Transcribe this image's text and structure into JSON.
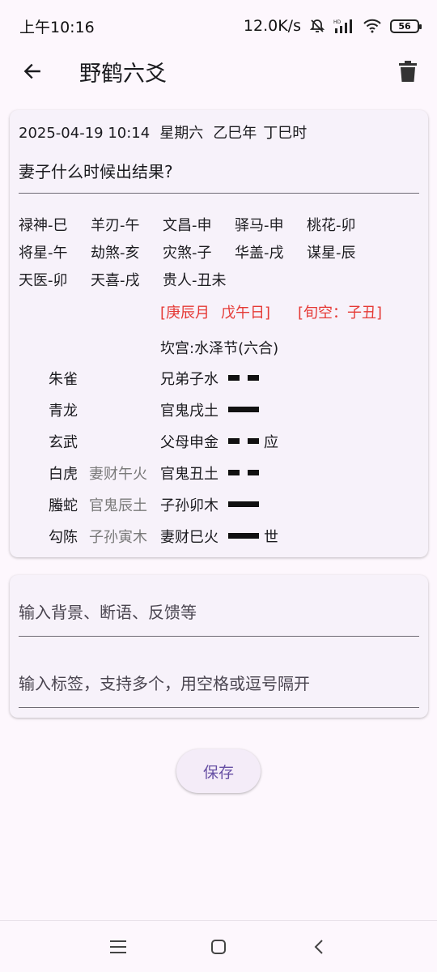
{
  "status": {
    "time": "上午10:16",
    "network_speed": "12.0K/s",
    "battery": "56"
  },
  "app_bar": {
    "title": "野鹤六爻"
  },
  "record": {
    "date_time": "2025-04-19 10:14",
    "weekday": "星期六",
    "year_pillar": "乙巳年",
    "hour_pillar": "丁巳时",
    "question": "妻子什么时候出结果?",
    "shensha": [
      [
        "禄神-巳",
        "羊刃-午",
        "文昌-申",
        "驿马-申",
        "桃花-卯"
      ],
      [
        "将星-午",
        "劫煞-亥",
        "灾煞-子",
        "华盖-戌",
        "谋星-辰"
      ],
      [
        "天医-卯",
        "天喜-戌",
        "贵人-丑未"
      ]
    ],
    "month": "[庚辰月",
    "day": "戊午日]",
    "xunkong": "[旬空：子丑]",
    "gua": "坎宫:水泽节(六合)",
    "yaos": [
      {
        "god": "朱雀",
        "fushen": "",
        "liuqin": "兄弟子水",
        "type": "yin",
        "mark": ""
      },
      {
        "god": "青龙",
        "fushen": "",
        "liuqin": "官鬼戌土",
        "type": "yang",
        "mark": ""
      },
      {
        "god": "玄武",
        "fushen": "",
        "liuqin": "父母申金",
        "type": "yin",
        "mark": "应"
      },
      {
        "god": "白虎",
        "fushen": "妻财午火",
        "liuqin": "官鬼丑土",
        "type": "yin",
        "mark": ""
      },
      {
        "god": "螣蛇",
        "fushen": "官鬼辰土",
        "liuqin": "子孙卯木",
        "type": "yang",
        "mark": ""
      },
      {
        "god": "勾陈",
        "fushen": "子孙寅木",
        "liuqin": "妻财巳火",
        "type": "yang",
        "mark": "世"
      }
    ]
  },
  "inputs": {
    "notes_placeholder": "输入背景、断语、反馈等",
    "notes_value": "",
    "tags_placeholder": "输入标签，支持多个，用空格或逗号隔开",
    "tags_value": ""
  },
  "save_label": "保存",
  "icons": {
    "back": "arrow-left-icon",
    "delete": "trash-icon",
    "nav_menu": "menu-icon",
    "nav_home": "home-icon",
    "nav_back": "chevron-left-icon"
  },
  "colors": {
    "accent": "#6750a4",
    "red": "#e53935",
    "muted": "#7a7a7a"
  }
}
